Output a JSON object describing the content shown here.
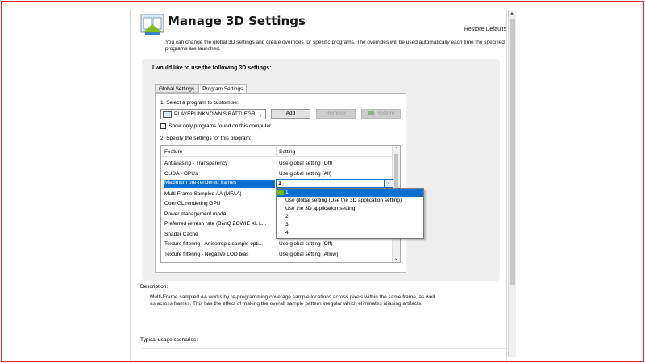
{
  "window": {
    "title": "Manage 3D Settings",
    "restore_defaults": "Restore Defaults",
    "intro": "You can change the global 3D settings and create overrides for specific programs. The overrides will be used automatically each time the specified programs are launched."
  },
  "settings_box": {
    "title": "I would like to use the following 3D settings:",
    "tabs": [
      {
        "label": "Global Settings",
        "active": false
      },
      {
        "label": "Program Settings",
        "active": true
      }
    ],
    "select_program_label": "1. Select a program to customise:",
    "program_value": "PLAYERUNKNOWN'S BATTLEGR...",
    "buttons": {
      "add": "Add",
      "remove": "Remove",
      "restore": "Restore"
    },
    "show_only_label": "Show only programs found on this computer",
    "specify_label": "2. Specify the settings for this program:",
    "grid": {
      "headers": {
        "feature": "Feature",
        "setting": "Setting"
      },
      "rows": [
        {
          "feature": "Antialiasing - Transparency",
          "setting": "Use global setting (Off)"
        },
        {
          "feature": "CUDA - GPUs",
          "setting": "Use global setting (All)"
        },
        {
          "feature": "Maximum pre-rendered frames",
          "setting": "",
          "selected": true
        },
        {
          "feature": "Multi-Frame Sampled AA (MFAA)",
          "setting": ""
        },
        {
          "feature": "OpenGL rendering GPU",
          "setting": ""
        },
        {
          "feature": "Power management mode",
          "setting": ""
        },
        {
          "feature": "Preferred refresh rate (BenQ ZOWIE XL L...",
          "setting": ""
        },
        {
          "feature": "Shader Cache",
          "setting": ""
        },
        {
          "feature": "Texture filtering - Anisotropic sample opti...",
          "setting": "Use global setting (Off)"
        },
        {
          "feature": "Texture filtering - Negative LOD bias",
          "setting": "Use global setting (Allow)"
        }
      ]
    },
    "combo_value": "1",
    "dropdown_options": [
      {
        "label": "1",
        "selected": true
      },
      {
        "label": "Use global setting (Use the 3D application setting)"
      },
      {
        "label": "Use the 3D application setting"
      },
      {
        "label": "2"
      },
      {
        "label": "3"
      },
      {
        "label": "4"
      }
    ]
  },
  "description": {
    "label": "Description:",
    "text": "Multi-Frame sampled AA works by re-programming coverage sample locations across pixels within the same frame, as well as across frames. This has the effect of making the overall sample pattern irregular which eliminates aliasing artifacts."
  },
  "usage": {
    "label": "Typical usage scenarios:"
  },
  "colors": {
    "frame_border": "#e3262b",
    "selection": "#0a6fd1",
    "nvidia_green": "#76b900"
  }
}
